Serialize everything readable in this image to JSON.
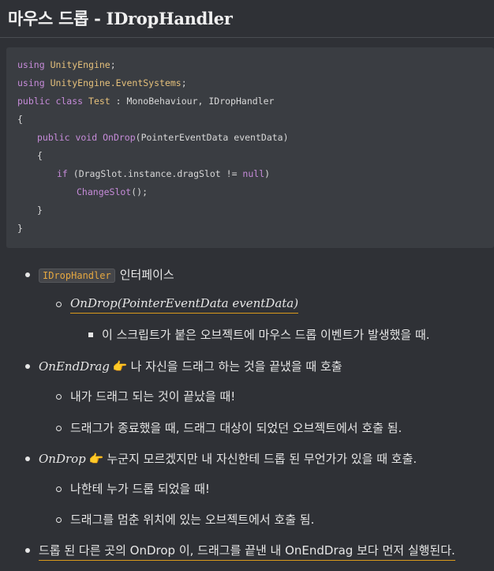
{
  "heading": "마우스 드롭 - IDropHandler",
  "code": {
    "line1": [
      "using",
      " ",
      "UnityEngine",
      ";"
    ],
    "line2": [
      "using",
      " ",
      "UnityEngine.EventSystems",
      ";"
    ],
    "line3": [
      "public class",
      " ",
      "Test",
      " : MonoBehaviour, IDropHandler"
    ],
    "line4": "{",
    "line5": [
      "public void",
      " ",
      "OnDrop",
      "(PointerEventData eventData)"
    ],
    "line6": "{",
    "line7": [
      "if",
      " (DragSlot.instance.dragSlot != ",
      "null",
      ")"
    ],
    "line8": [
      "ChangeSlot",
      "();"
    ],
    "line9": "}",
    "line10": "}"
  },
  "list": {
    "item1_code": "IDropHandler",
    "item1_text": "인터페이스",
    "item1_sub": "OnDrop(PointerEventData eventData)",
    "item1_subsub": "이 스크립트가 붙은 오브젝트에 마우스 드롭 이벤트가 발생했을 때.",
    "item2_name": "OnEndDrag",
    "item2_icon": "👉",
    "item2_text": "나 자신을 드래그 하는 것을 끝냈을 때 호출",
    "item2_sub1": "내가 드래그 되는 것이 끝났을 때!",
    "item2_sub2": "드래그가 종료했을 때, 드래그 대상이 되었던 오브젝트에서 호출 됨.",
    "item3_name": "OnDrop",
    "item3_icon": "👉",
    "item3_text": "누군지 모르겠지만 내 자신한테 드롭 된 무언가가 있을 때 호출.",
    "item3_sub1": "나한테 누가 드롭 되었을 때!",
    "item3_sub2": "드래그를 멈춘 위치에 있는 오브젝트에서 호출 됨.",
    "item4_text": "드롭 된 다른 곳의 OnDrop 이, 드래그를 끝낸 내 OnEndDrag 보다 먼저 실행된다."
  }
}
